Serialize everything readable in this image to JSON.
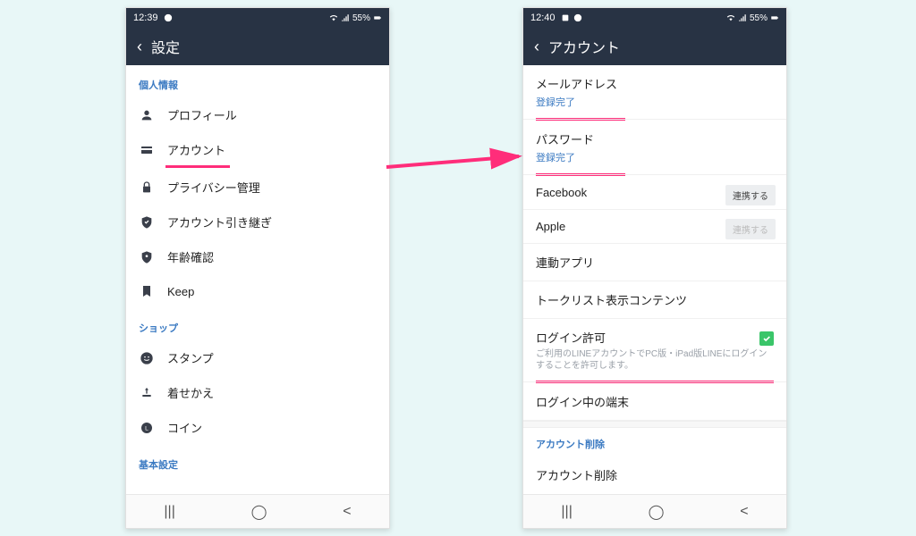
{
  "left": {
    "status": {
      "time": "12:39",
      "battery": "55%"
    },
    "title": "設定",
    "sections": [
      {
        "header": "個人情報",
        "items": [
          {
            "icon": "person",
            "label": "プロフィール"
          },
          {
            "icon": "card",
            "label": "アカウント",
            "highlight": true
          },
          {
            "icon": "lock",
            "label": "プライバシー管理"
          },
          {
            "icon": "shield",
            "label": "アカウント引き継ぎ"
          },
          {
            "icon": "badge",
            "label": "年齢確認"
          },
          {
            "icon": "bookmark",
            "label": "Keep"
          }
        ]
      },
      {
        "header": "ショップ",
        "items": [
          {
            "icon": "smile",
            "label": "スタンプ"
          },
          {
            "icon": "theme",
            "label": "着せかえ"
          },
          {
            "icon": "coin",
            "label": "コイン"
          }
        ]
      },
      {
        "header": "基本設定",
        "items": []
      }
    ]
  },
  "right": {
    "status": {
      "time": "12:40",
      "battery": "55%"
    },
    "title": "アカウント",
    "rows": {
      "email": {
        "label": "メールアドレス",
        "sub": "登録完了",
        "highlight": true
      },
      "password": {
        "label": "パスワード",
        "sub": "登録完了",
        "highlight": true
      },
      "fb": {
        "label": "Facebook",
        "button": "連携する"
      },
      "apple": {
        "label": "Apple",
        "button": "連携する",
        "disabled": true
      },
      "linked": {
        "label": "連動アプリ"
      },
      "talk": {
        "label": "トークリスト表示コンテンツ"
      },
      "login": {
        "label": "ログイン許可",
        "desc": "ご利用のLINEアカウントでPC版・iPad版LINEにログインすることを許可します。",
        "checked": true,
        "highlight": true
      },
      "devices": {
        "label": "ログイン中の端末"
      },
      "delHeader": "アカウント削除",
      "del": {
        "label": "アカウント削除"
      }
    }
  }
}
